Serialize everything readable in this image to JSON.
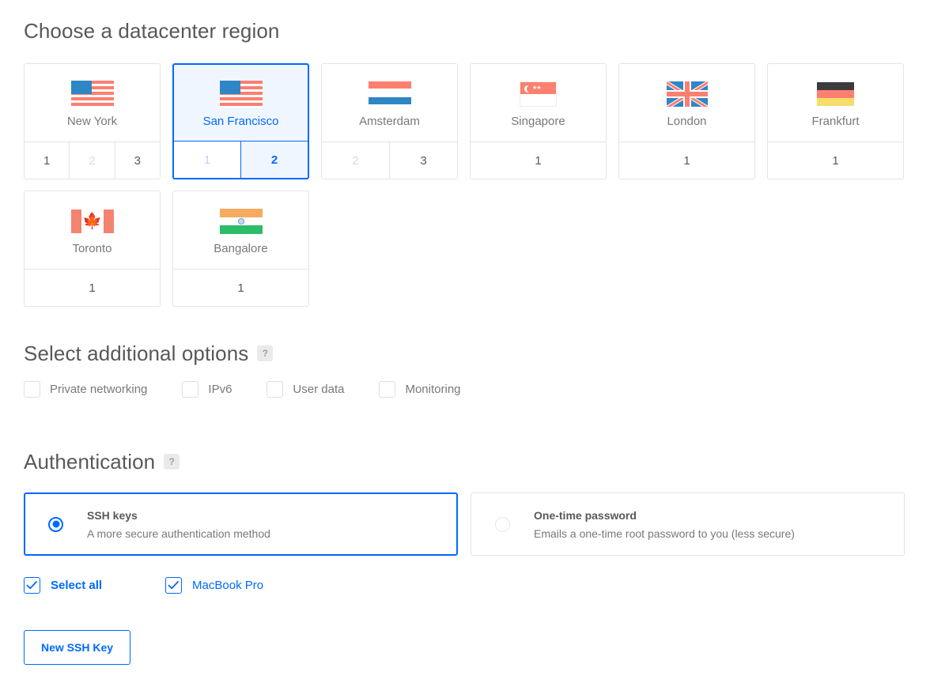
{
  "regions": {
    "title": "Choose a datacenter region",
    "cards": [
      {
        "name": "New York",
        "flag": "us",
        "selected": false,
        "datacenters": [
          {
            "label": "1",
            "state": "enabled"
          },
          {
            "label": "2",
            "state": "disabled"
          },
          {
            "label": "3",
            "state": "enabled"
          }
        ]
      },
      {
        "name": "San Francisco",
        "flag": "us",
        "selected": true,
        "datacenters": [
          {
            "label": "1",
            "state": "disabled"
          },
          {
            "label": "2",
            "state": "active"
          }
        ]
      },
      {
        "name": "Amsterdam",
        "flag": "nl",
        "selected": false,
        "datacenters": [
          {
            "label": "2",
            "state": "disabled"
          },
          {
            "label": "3",
            "state": "enabled"
          }
        ]
      },
      {
        "name": "Singapore",
        "flag": "sg",
        "selected": false,
        "datacenters": [
          {
            "label": "1",
            "state": "enabled"
          }
        ]
      },
      {
        "name": "London",
        "flag": "gb",
        "selected": false,
        "datacenters": [
          {
            "label": "1",
            "state": "enabled"
          }
        ]
      },
      {
        "name": "Frankfurt",
        "flag": "de",
        "selected": false,
        "datacenters": [
          {
            "label": "1",
            "state": "enabled"
          }
        ]
      },
      {
        "name": "Toronto",
        "flag": "ca",
        "selected": false,
        "datacenters": [
          {
            "label": "1",
            "state": "enabled"
          }
        ]
      },
      {
        "name": "Bangalore",
        "flag": "in",
        "selected": false,
        "datacenters": [
          {
            "label": "1",
            "state": "enabled"
          }
        ]
      }
    ]
  },
  "options": {
    "title": "Select additional options",
    "help_glyph": "?",
    "items": [
      {
        "label": "Private networking",
        "checked": false
      },
      {
        "label": "IPv6",
        "checked": false
      },
      {
        "label": "User data",
        "checked": false
      },
      {
        "label": "Monitoring",
        "checked": false
      }
    ]
  },
  "authentication": {
    "title": "Authentication",
    "help_glyph": "?",
    "methods": [
      {
        "title": "SSH keys",
        "description": "A more secure authentication method",
        "selected": true
      },
      {
        "title": "One-time password",
        "description": "Emails a one-time root password to you (less secure)",
        "selected": false
      }
    ],
    "keys": [
      {
        "label": "Select all",
        "checked": true,
        "bold": true
      },
      {
        "label": "MacBook Pro",
        "checked": true,
        "bold": false
      }
    ],
    "new_key_button": "New SSH Key"
  },
  "colors": {
    "accent_blue": "#0069ff",
    "selected_bg": "#f0f6ff",
    "flag_red": "#fc7f6f",
    "flag_blue": "#2f86c5",
    "text_gray": "#76797c",
    "border_gray": "#e1e4e6"
  }
}
